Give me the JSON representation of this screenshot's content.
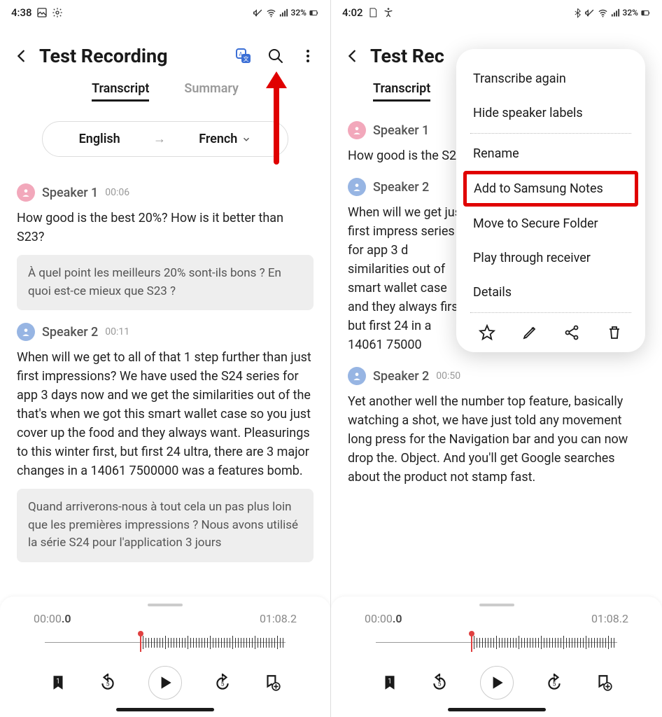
{
  "left": {
    "status": {
      "time": "4:38",
      "battery": "32%"
    },
    "title": "Test Recording",
    "tabs": {
      "transcript": "Transcript",
      "summary": "Summary"
    },
    "lang": {
      "from": "English",
      "to": "French"
    },
    "segments": [
      {
        "speaker": "Speaker 1",
        "time": "00:06",
        "color": "pink",
        "text": "How good is the best 20%? How is it better than S23?",
        "translation": "À quel point les meilleurs 20% sont-ils bons ? En quoi est-ce mieux que S23 ?"
      },
      {
        "speaker": "Speaker 2",
        "time": "00:11",
        "color": "blue",
        "text": "When will we get to all of that 1 step further than just first impressions? We have used the S24 series for app 3 days now and we get the similarities out of the that's when we got this smart wallet case so you just cover up the food and they always want. Pleasurings to this winter first, but first 24 ultra, there are 3 major changes in a 14061 7500000 was a features bomb.",
        "translation": "Quand arriverons-nous à tout cela un pas plus loin que les premières impressions ? Nous avons utilisé la série S24 pour l'application 3 jours"
      }
    ],
    "player": {
      "current": "00:00",
      "current_frac": ".0",
      "total": "01:08.2"
    }
  },
  "right": {
    "status": {
      "time": "4:02",
      "battery": "32%"
    },
    "title": "Test Rec",
    "tabs": {
      "transcript": "Transcript"
    },
    "segments": [
      {
        "speaker": "Speaker 1",
        "time": "",
        "color": "pink",
        "text": "How good is the S23?"
      },
      {
        "speaker": "Speaker 2",
        "time": "",
        "color": "blue",
        "text": "When will we get just first impress series for app 3 d similarities out of smart wallet case and they always first, but first 24 in a 14061 75000"
      },
      {
        "speaker": "Speaker 2",
        "time": "00:50",
        "color": "blue",
        "text": "Yet another well the number top feature, basically watching a shot, we have just told any movement long press for the Navigation bar and you can now drop the. Object. And you'll get Google searches about the product not stamp fast."
      }
    ],
    "player": {
      "current": "00:00",
      "current_frac": ".0",
      "total": "01:08.2"
    },
    "menu": {
      "items_top": [
        "Transcribe again",
        "Hide speaker labels"
      ],
      "items_mid": [
        "Rename",
        "Add to Samsung Notes",
        "Move to Secure Folder",
        "Play through receiver",
        "Details"
      ],
      "highlight_index": 1
    }
  }
}
